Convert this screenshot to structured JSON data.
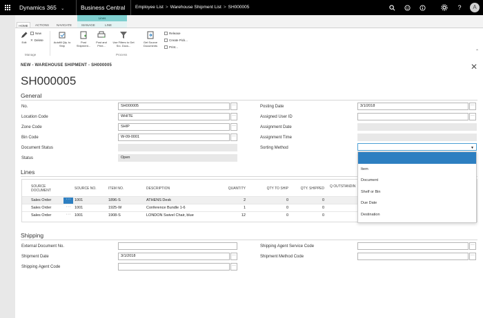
{
  "topbar": {
    "app_name": "Dynamics 365",
    "product_name": "Business Central",
    "breadcrumbs": [
      "Employee List",
      "Warehouse Shipment List",
      "SH000005"
    ],
    "icons": [
      "waffle-icon",
      "search-icon",
      "smiley-icon",
      "help-icon",
      "settings-icon",
      "help-question-icon",
      "user-avatar"
    ],
    "avatar_initial": "A"
  },
  "ribbon": {
    "tabs": [
      "HOME",
      "ACTIONS",
      "NAVIGATE",
      "MANAGE",
      "LINE"
    ],
    "context_group": "Lines",
    "manage_group_label": "Manage",
    "process_group_label": "Process",
    "buttons": {
      "edit": "Edit",
      "new": "New",
      "delete": "Delete",
      "autofill": "Autofill Qty. to Ship",
      "post_shipment": "Post Shipment...",
      "post_print": "Post and Print...",
      "use_filters": "Use Filters to Get Src. Docs...",
      "get_source": "Get Source Documents",
      "release": "Release",
      "create_pick": "Create Pick...",
      "print": "Print..."
    }
  },
  "card": {
    "header": "NEW - WAREHOUSE SHIPMENT - SH000005",
    "title": "SH000005"
  },
  "general": {
    "section_title": "General",
    "no_label": "No.",
    "no_value": "SH000005",
    "location_label": "Location Code",
    "location_value": "WHITE",
    "zone_label": "Zone Code",
    "zone_value": "SHIP",
    "bin_label": "Bin Code",
    "bin_value": "W-09-0001",
    "doc_status_label": "Document Status",
    "doc_status_value": "",
    "status_label": "Status",
    "status_value": "Open",
    "posting_date_label": "Posting Date",
    "posting_date_value": "3/1/2018",
    "assigned_user_label": "Assigned User ID",
    "assigned_user_value": "",
    "assignment_date_label": "Assignment Date",
    "assignment_time_label": "Assignment Time",
    "sorting_method_label": "Sorting Method",
    "sorting_method_value": ""
  },
  "sorting_dropdown": {
    "options": [
      "",
      "Item",
      "Document",
      "Shelf or Bin",
      "Due Date",
      "Destination"
    ]
  },
  "lines": {
    "section_title": "Lines",
    "columns": {
      "source_doc": "SOURCE DOCUMENT",
      "source_no": "SOURCE NO.",
      "item_no": "ITEM NO.",
      "description": "DESCRIPTION",
      "quantity": "QUANTITY",
      "qty_to_ship": "QTY TO SHIP",
      "qty_shipped": "QTY. SHIPPED",
      "qty_outstanding": "Q OUTSTANDIN"
    },
    "rows": [
      {
        "source_doc": "Sales Order",
        "source_no": "1001",
        "item_no": "1896-S",
        "description": "ATHENS Desk",
        "quantity": "2",
        "qty_to_ship": "0",
        "qty_shipped": "0"
      },
      {
        "source_doc": "Sales Order",
        "source_no": "1001",
        "item_no": "1925-W",
        "description": "Conference Bundle 1-6",
        "quantity": "1",
        "qty_to_ship": "0",
        "qty_shipped": "0"
      },
      {
        "source_doc": "Sales Order",
        "source_no": "1001",
        "item_no": "1908-S",
        "description": "LONDON Swivel Chair, blue",
        "quantity": "12",
        "qty_to_ship": "0",
        "qty_shipped": "0"
      }
    ]
  },
  "shipping": {
    "section_title": "Shipping",
    "ext_doc_label": "External Document No.",
    "ext_doc_value": "",
    "shipment_date_label": "Shipment Date",
    "shipment_date_value": "3/1/2018",
    "agent_code_label": "Shipping Agent Code",
    "agent_code_value": "",
    "agent_service_label": "Shipping Agent Service Code",
    "agent_service_value": "",
    "method_code_label": "Shipment Method Code",
    "method_code_value": ""
  },
  "colors": {
    "accent": "#2d7fc1",
    "context_tab": "#7fcfcf",
    "topbar": "#000000"
  }
}
